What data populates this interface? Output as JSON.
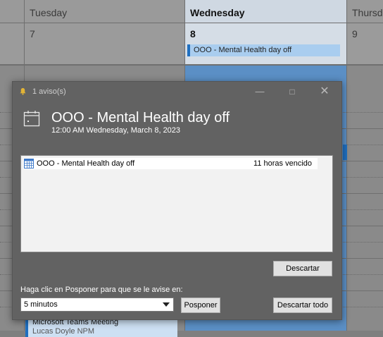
{
  "calendar": {
    "days": [
      {
        "name": "Tuesday",
        "number": "7"
      },
      {
        "name": "Wednesday",
        "number": "8"
      },
      {
        "name": "Thursd",
        "number": "9"
      }
    ],
    "events": {
      "wednesday_allday": "OOO - Mental Health day off",
      "bottom_line1": "Microsoft Teams Meeting",
      "bottom_line2": "Lucas Doyle NPM"
    }
  },
  "reminder": {
    "title": "1 aviso(s)",
    "subject": "OOO - Mental Health day off",
    "when": "12:00 AM Wednesday, March 8, 2023",
    "items": [
      {
        "subject": "OOO - Mental Health day off",
        "due": "11 horas vencido"
      }
    ],
    "dismiss_label": "Descartar",
    "snooze_prompt": "Haga clic en Posponer para que se le avise en:",
    "snooze_value": "5 minutos",
    "snooze_label": "Posponer",
    "dismiss_all_label": "Descartar todo"
  },
  "icons": [
    "bell-icon",
    "calendar-icon",
    "minimize-icon",
    "maximize-icon",
    "close-icon",
    "chevron-down-icon"
  ],
  "colors": {
    "accent": "#1f6fc0",
    "window_bg": "#626262",
    "event_bg": "#a9cdef"
  }
}
